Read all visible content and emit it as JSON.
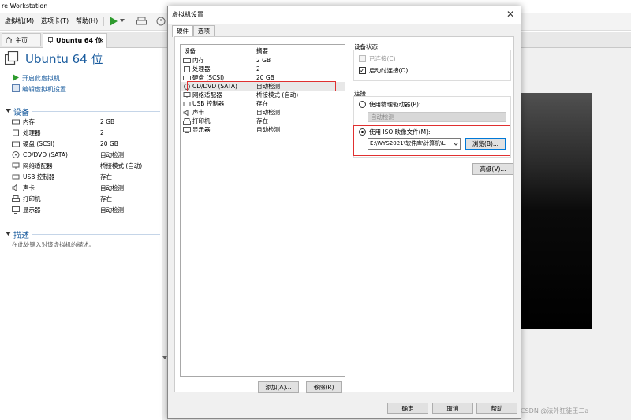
{
  "window": {
    "title": "re Workstation"
  },
  "menubar": {
    "items": [
      "虚拟机(M)",
      "选项卡(T)",
      "帮助(H)"
    ]
  },
  "tabs": [
    {
      "label": "主页"
    },
    {
      "label": "Ubuntu 64 位"
    }
  ],
  "left": {
    "vm_title": "Ubuntu 64 位",
    "actions": [
      "开启此虚拟机",
      "编辑虚拟机设置"
    ],
    "devices_header": "设备",
    "devices": [
      {
        "name": "内存",
        "value": "2 GB",
        "icon": "memory-icon"
      },
      {
        "name": "处理器",
        "value": "2",
        "icon": "cpu-icon"
      },
      {
        "name": "硬盘 (SCSI)",
        "value": "20 GB",
        "icon": "hard-disk-icon"
      },
      {
        "name": "CD/DVD (SATA)",
        "value": "自动检测",
        "icon": "cd-dvd-icon"
      },
      {
        "name": "网络适配器",
        "value": "桥接模式 (自动)",
        "icon": "network-icon"
      },
      {
        "name": "USB 控制器",
        "value": "存在",
        "icon": "usb-icon"
      },
      {
        "name": "声卡",
        "value": "自动检测",
        "icon": "sound-icon"
      },
      {
        "name": "打印机",
        "value": "存在",
        "icon": "printer-icon"
      },
      {
        "name": "显示器",
        "value": "自动检测",
        "icon": "display-icon"
      }
    ],
    "description_header": "描述",
    "description_placeholder": "在此处键入对该虚拟机的描述。"
  },
  "dialog": {
    "title": "虚拟机设置",
    "tabs": [
      "硬件",
      "选项"
    ],
    "list_headers": {
      "device": "设备",
      "summary": "摘要"
    },
    "devices": [
      {
        "name": "内存",
        "value": "2 GB"
      },
      {
        "name": "处理器",
        "value": "2"
      },
      {
        "name": "硬盘 (SCSI)",
        "value": "20 GB"
      },
      {
        "name": "CD/DVD (SATA)",
        "value": "自动检测"
      },
      {
        "name": "网络适配器",
        "value": "桥接模式 (自动)"
      },
      {
        "name": "USB 控制器",
        "value": "存在"
      },
      {
        "name": "声卡",
        "value": "自动检测"
      },
      {
        "name": "打印机",
        "value": "存在"
      },
      {
        "name": "显示器",
        "value": "自动检测"
      }
    ],
    "add_button": "添加(A)...",
    "remove_button": "移除(R)",
    "device_status": {
      "label": "设备状态",
      "connected": "已连接(C)",
      "connect_on_power": "启动时连接(O)"
    },
    "connection": {
      "label": "连接",
      "physical_drive": "使用物理驱动器(P):",
      "physical_drive_value": "自动检测",
      "iso": "使用 ISO 映像文件(M):",
      "iso_path": "E:\\WYS2021\\软件库\\计算机\\L",
      "browse": "浏览(B)..."
    },
    "advanced": "高级(V)...",
    "ok": "确定",
    "cancel": "取消",
    "help": "帮助"
  },
  "watermark": "CSDN @法外狂徒王二a",
  "colors": {
    "accent": "#1a5c9e",
    "highlight_box": "#e03030"
  }
}
